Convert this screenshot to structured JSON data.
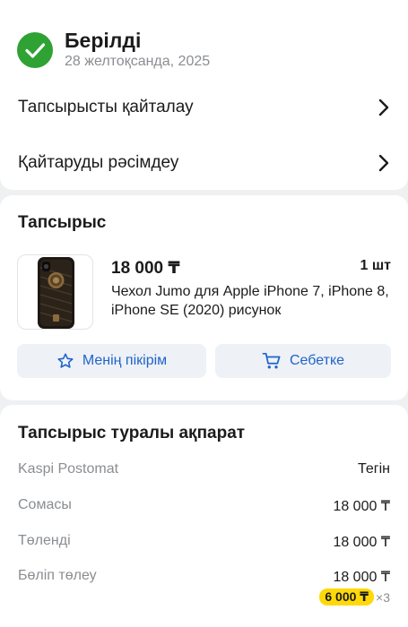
{
  "status": {
    "title": "Берілді",
    "date": "28 желтоқсанда, 2025",
    "icon": "check-circle-icon",
    "color": "#2ea233"
  },
  "actions": [
    {
      "label": "Тапсырысты қайталау",
      "icon": "chevron-right-icon"
    },
    {
      "label": "Қайтаруды рәсімдеу",
      "icon": "chevron-right-icon"
    }
  ],
  "order": {
    "heading": "Тапсырыс",
    "item": {
      "price": "18 000 ₸",
      "quantity": "1 шт",
      "name": "Чехол Jumo для Apple iPhone 7, iPhone 8, iPhone SE (2020) рисунок",
      "image_icon": "phone-case-image"
    },
    "buttons": {
      "review": {
        "label": "Менің пікірім",
        "icon": "star-icon"
      },
      "cart": {
        "label": "Себетке",
        "icon": "cart-icon"
      }
    }
  },
  "info": {
    "heading": "Тапсырыс туралы ақпарат",
    "rows": [
      {
        "label": "Kaspi Postomat",
        "value": "Тегін"
      },
      {
        "label": "Сомасы",
        "value": "18 000 ₸"
      },
      {
        "label": "Төленді",
        "value": "18 000 ₸"
      },
      {
        "label": "Бөліп төлеу",
        "value": "18 000 ₸"
      }
    ],
    "installment": {
      "amount": "6 000 ₸",
      "multiplier": "×3"
    }
  },
  "colors": {
    "accent": "#1f64c9",
    "success": "#2ea233",
    "installment_badge": "#ffd80a"
  }
}
